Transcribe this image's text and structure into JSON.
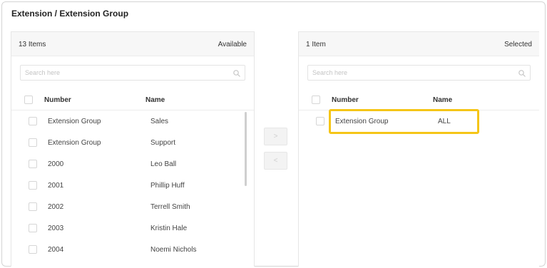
{
  "title": "Extension / Extension Group",
  "available": {
    "count_label": "13 Items",
    "state_label": "Available",
    "search_placeholder": "Search here",
    "columns": {
      "number": "Number",
      "name": "Name"
    },
    "rows": [
      {
        "number": "Extension Group",
        "name": "Sales"
      },
      {
        "number": "Extension Group",
        "name": "Support"
      },
      {
        "number": "2000",
        "name": "Leo Ball"
      },
      {
        "number": "2001",
        "name": "Phillip Huff"
      },
      {
        "number": "2002",
        "name": "Terrell Smith"
      },
      {
        "number": "2003",
        "name": "Kristin Hale"
      },
      {
        "number": "2004",
        "name": "Noemi Nichols"
      }
    ]
  },
  "selected": {
    "count_label": "1 Item",
    "state_label": "Selected",
    "search_placeholder": "Search here",
    "columns": {
      "number": "Number",
      "name": "Name"
    },
    "rows": [
      {
        "number": "Extension Group",
        "name": "ALL"
      }
    ]
  },
  "transfer": {
    "move_right_icon": "chevron-right",
    "move_left_icon": "chevron-left",
    "move_right_glyph": ">",
    "move_left_glyph": "<"
  },
  "colors": {
    "highlight": "#f5c518",
    "header_bg": "#f7f7f7"
  }
}
